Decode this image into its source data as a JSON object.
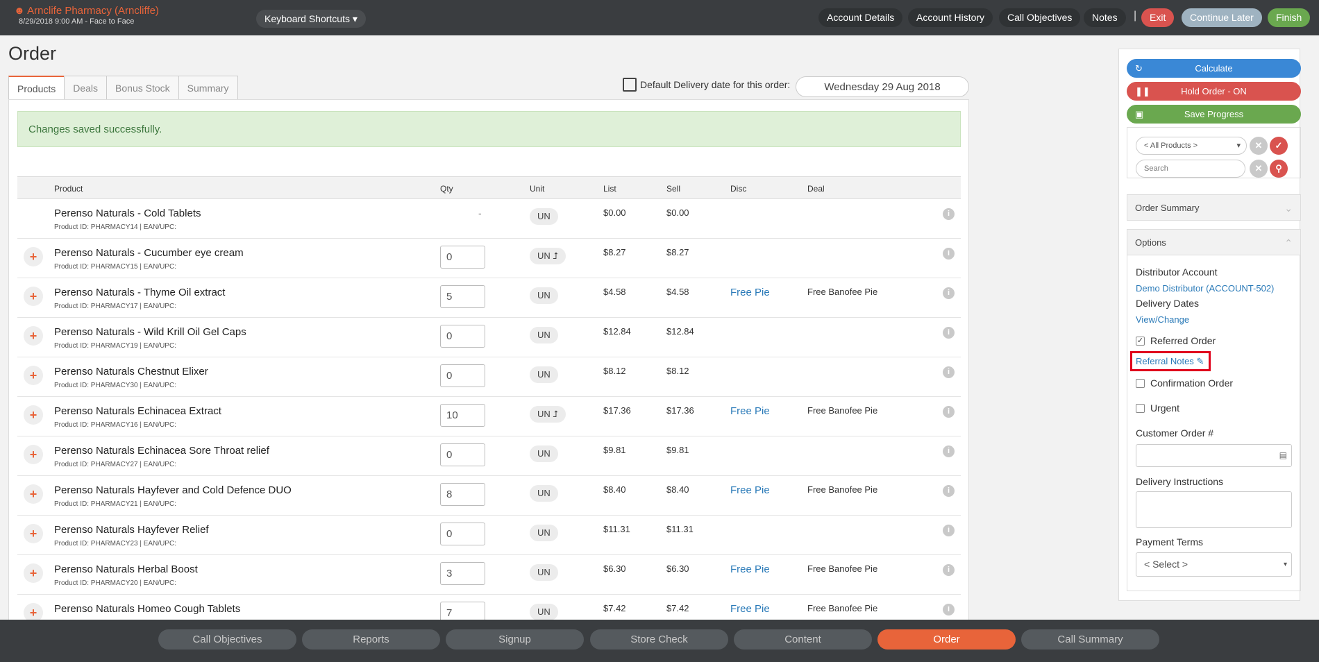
{
  "topbar": {
    "store_name": "Arnclife Pharmacy (Arncliffe)",
    "store_sub": "8/29/2018 9:00 AM - Face to Face",
    "keyboard_shortcuts": "Keyboard Shortcuts",
    "buttons": {
      "account_details": "Account Details",
      "account_history": "Account History",
      "call_objectives": "Call Objectives",
      "notes": "Notes",
      "separator": "|",
      "exit": "Exit",
      "continue_later": "Continue Later",
      "finish": "Finish"
    }
  },
  "page": {
    "title": "Order",
    "tabs": [
      "Products",
      "Deals",
      "Bonus Stock",
      "Summary"
    ],
    "delivery_label": "Default Delivery date for this order:",
    "delivery_date": "Wednesday 29 Aug 2018",
    "alert": "Changes saved successfully."
  },
  "table": {
    "headers": {
      "product": "Product",
      "qty": "Qty",
      "unit": "Unit",
      "list": "List",
      "sell": "Sell",
      "disc": "Disc",
      "deal": "Deal"
    },
    "rows": [
      {
        "name": "Perenso Naturals - Cold Tablets",
        "pid": "Product ID: PHARMACY14 | EAN/UPC:",
        "qty": "-",
        "unit": "UN",
        "list": "$0.00",
        "sell": "$0.00",
        "disc": "",
        "deal": ""
      },
      {
        "name": "Perenso Naturals - Cucumber eye cream",
        "pid": "Product ID: PHARMACY15 | EAN/UPC:",
        "qty": "0",
        "unit": "UN ⮥",
        "list": "$8.27",
        "sell": "$8.27",
        "disc": "",
        "deal": ""
      },
      {
        "name": "Perenso Naturals - Thyme Oil extract",
        "pid": "Product ID: PHARMACY17 | EAN/UPC:",
        "qty": "5",
        "unit": "UN",
        "list": "$4.58",
        "sell": "$4.58",
        "disc": "Free Pie",
        "deal": "Free Banofee Pie"
      },
      {
        "name": "Perenso Naturals - Wild Krill Oil Gel Caps",
        "pid": "Product ID: PHARMACY19 | EAN/UPC:",
        "qty": "0",
        "unit": "UN",
        "list": "$12.84",
        "sell": "$12.84",
        "disc": "",
        "deal": ""
      },
      {
        "name": "Perenso Naturals Chestnut Elixer",
        "pid": "Product ID: PHARMACY30 | EAN/UPC:",
        "qty": "0",
        "unit": "UN",
        "list": "$8.12",
        "sell": "$8.12",
        "disc": "",
        "deal": ""
      },
      {
        "name": "Perenso Naturals Echinacea Extract",
        "pid": "Product ID: PHARMACY16 | EAN/UPC:",
        "qty": "10",
        "unit": "UN ⮥",
        "list": "$17.36",
        "sell": "$17.36",
        "disc": "Free Pie",
        "deal": "Free Banofee Pie"
      },
      {
        "name": "Perenso Naturals Echinacea Sore Throat relief",
        "pid": "Product ID: PHARMACY27 | EAN/UPC:",
        "qty": "0",
        "unit": "UN",
        "list": "$9.81",
        "sell": "$9.81",
        "disc": "",
        "deal": ""
      },
      {
        "name": "Perenso Naturals Hayfever and Cold Defence DUO",
        "pid": "Product ID: PHARMACY21 | EAN/UPC:",
        "qty": "8",
        "unit": "UN",
        "list": "$8.40",
        "sell": "$8.40",
        "disc": "Free Pie",
        "deal": "Free Banofee Pie"
      },
      {
        "name": "Perenso Naturals Hayfever Relief",
        "pid": "Product ID: PHARMACY23 | EAN/UPC:",
        "qty": "0",
        "unit": "UN",
        "list": "$11.31",
        "sell": "$11.31",
        "disc": "",
        "deal": ""
      },
      {
        "name": "Perenso Naturals Herbal Boost",
        "pid": "Product ID: PHARMACY20 | EAN/UPC:",
        "qty": "3",
        "unit": "UN",
        "list": "$6.30",
        "sell": "$6.30",
        "disc": "Free Pie",
        "deal": "Free Banofee Pie"
      },
      {
        "name": "Perenso Naturals Homeo Cough Tablets",
        "pid": "",
        "qty": "7",
        "unit": "UN",
        "list": "$7.42",
        "sell": "$7.42",
        "disc": "Free Pie",
        "deal": "Free Banofee Pie"
      }
    ]
  },
  "sidebar": {
    "calculate": "Calculate",
    "hold_order": "Hold Order - ON",
    "save_progress": "Save Progress",
    "filter_select": "< All Products >",
    "search_placeholder": "Search",
    "order_summary": "Order Summary",
    "options": "Options",
    "distributor_account_label": "Distributor Account",
    "distributor_account_value": "Demo Distributor (ACCOUNT-502)",
    "delivery_dates_label": "Delivery Dates",
    "delivery_dates_link": "View/Change",
    "referred_order": "Referred Order",
    "referral_notes": "Referral Notes",
    "confirmation_order": "Confirmation Order",
    "urgent": "Urgent",
    "customer_order": "Customer Order #",
    "delivery_instructions": "Delivery Instructions",
    "payment_terms": "Payment Terms",
    "payment_select": "< Select >"
  },
  "bottom_nav": [
    "Call Objectives",
    "Reports",
    "Signup",
    "Store Check",
    "Content",
    "Order",
    "Call Summary"
  ],
  "colors": {
    "accent": "#e8643a",
    "calculate": "#3a88d6",
    "hold": "#d9534f",
    "save": "#6aa84f",
    "link": "#2a7ab8"
  }
}
